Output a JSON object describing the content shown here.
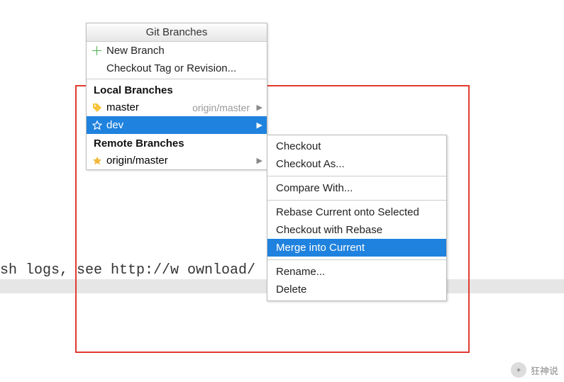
{
  "background": {
    "text": "sh logs, see http://w                   ownload/"
  },
  "popup": {
    "title": "Git Branches",
    "new_branch": "New Branch",
    "checkout_tag": "Checkout Tag or Revision...",
    "local_header": "Local Branches",
    "remote_header": "Remote Branches",
    "local": [
      {
        "name": "master",
        "upstream": "origin/master"
      },
      {
        "name": "dev",
        "upstream": ""
      }
    ],
    "remote": [
      {
        "name": "origin/master"
      }
    ]
  },
  "submenu": {
    "items": [
      "Checkout",
      "Checkout As...",
      "-",
      "Compare With...",
      "-",
      "Rebase Current onto Selected",
      "Checkout with Rebase",
      "Merge into Current",
      "-",
      "Rename...",
      "Delete"
    ],
    "selected": "Merge into Current"
  },
  "watermark": {
    "text": "狂神说"
  }
}
